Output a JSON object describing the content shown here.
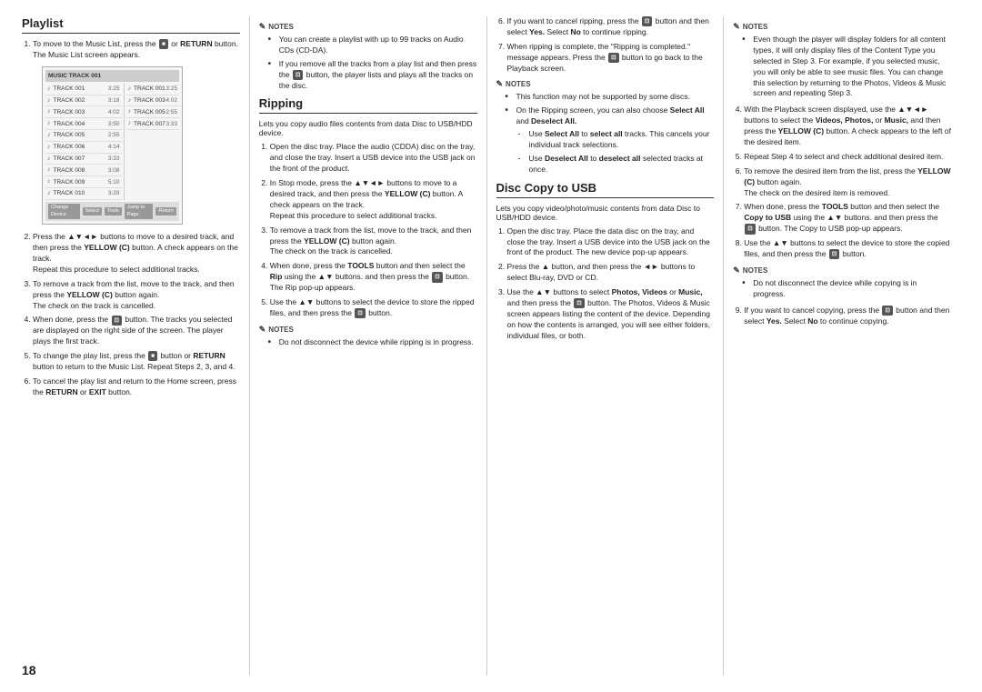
{
  "page": {
    "number": "18",
    "cols": {
      "col1": {
        "heading": "Playlist",
        "items": [
          {
            "num": "1",
            "text": "To move to the Music List, press the",
            "btn": "■",
            "text2": "or",
            "bold2": "RETURN",
            "text3": "button.",
            "sub": "The Music List screen appears."
          },
          {
            "num": "2",
            "text": "Press the ▲▼◄► buttons to move to a desired track, and then press the",
            "bold": "YELLOW (C)",
            "text2": "button. A check appears on the track.",
            "sub": "Repeat this procedure to select additional tracks."
          },
          {
            "num": "3",
            "text": "To remove a track from the list, move to the track, and then press the",
            "bold": "YELLOW (C)",
            "text2": "button again.",
            "sub": "The check on the track is cancelled."
          },
          {
            "num": "4",
            "text": "When done, press the",
            "btn": "■",
            "text2": "button. The tracks you selected are displayed on the right side of the screen. The player plays the first track."
          },
          {
            "num": "5",
            "text": "To change the play list, press the",
            "btn2": "■",
            "text2": "button or",
            "bold2": "RETURN",
            "text3": "button to return to the Music List. Repeat Steps 2, 3, and 4."
          },
          {
            "num": "6",
            "text": "To cancel the play list and return to the Home screen, press the",
            "bold": "RETURN",
            "text2": "or",
            "bold2": "EXIT",
            "text3": "button."
          }
        ],
        "musiclist": {
          "header": "MUSIC TRACK 001",
          "tracks": [
            {
              "name": "TRACK 001",
              "time": "3:25"
            },
            {
              "name": "TRACK 002",
              "time": "3:18"
            },
            {
              "name": "TRACK 003",
              "time": "4:02"
            },
            {
              "name": "TRACK 004",
              "time": "3:50"
            },
            {
              "name": "TRACK 005",
              "time": "2:55"
            },
            {
              "name": "TRACK 006",
              "time": "4:14"
            },
            {
              "name": "TRACK 007",
              "time": "3:33"
            },
            {
              "name": "TRACK 008",
              "time": "3:08"
            },
            {
              "name": "TRACK 009",
              "time": "5:10"
            },
            {
              "name": "TRACK 010",
              "time": "3:29"
            }
          ],
          "rightTracks": [
            {
              "name": "TRACK 001",
              "time": "3:25"
            },
            {
              "name": "TRACK 003",
              "time": "4:02"
            },
            {
              "name": "TRACK 005",
              "time": "2:55"
            },
            {
              "name": "TRACK 007",
              "time": "3:33"
            }
          ],
          "toolbar": [
            "Change Device",
            "Select",
            "Tools",
            "Jump to Page",
            "Return"
          ]
        }
      },
      "col2": {
        "heading": "Ripping",
        "notes1": {
          "label": "NOTES",
          "items": [
            "You can create a playlist with up to 99 tracks on Audio CDs (CD-DA).",
            "If you remove all the tracks from a play list and then press the button, the player lists and plays all the tracks on the disc."
          ]
        },
        "intro": "Lets you copy audio files contents from data Disc to USB/HDD device.",
        "items": [
          {
            "num": "1",
            "text": "Open the disc tray. Place the audio (CDDA) disc on the tray, and close the tray. Insert a USB device into the USB jack on the front of the product."
          },
          {
            "num": "2",
            "text": "In Stop mode, press the ▲▼◄► buttons to move to a desired track, and then press the",
            "bold": "YELLOW (C)",
            "text2": "button. A check appears on the track.",
            "sub": "Repeat this procedure to select additional tracks."
          },
          {
            "num": "3",
            "text": "To remove a track from the list, move to the track, and then press the",
            "bold": "YELLOW (C)",
            "text2": "button again.",
            "sub": "The check on the track is cancelled."
          },
          {
            "num": "4",
            "text": "When done, press the",
            "bold": "TOOLS",
            "text2": "button and then select the",
            "bold2": "Rip",
            "text3": "using the ▲▼ buttons. and then press the",
            "btn": "⊡",
            "text4": "button. The Rip pop-up appears."
          },
          {
            "num": "5",
            "text": "Use the ▲▼ buttons to select the device to store the ripped files, and then press the",
            "btn": "⊡",
            "text2": "button."
          }
        ],
        "notes2": {
          "label": "NOTES",
          "items": [
            "Do not disconnect the device while ripping is in progress."
          ]
        }
      },
      "col3": {
        "notes1": {
          "label": "NOTES",
          "items": [
            "This function may not be supported by some discs.",
            "On the Ripping screen, you can also choose Select All and Deselect All."
          ],
          "subitems": [
            {
              "bold": "Select All",
              "text": "to select all tracks.",
              "sub": "This cancels your individual track selections."
            },
            {
              "bold": "Deselect All",
              "text": "to deselect all selected tracks at once."
            }
          ]
        },
        "heading2": "Disc Copy to USB",
        "intro": "Lets you copy video/photo/music contents from data Disc to USB/HDD device.",
        "items": [
          {
            "num": "1",
            "text": "Open the disc tray. Place the data disc on the tray, and close the tray. Insert a USB device into the USB jack on the front of the product. The new device pop-up appears."
          },
          {
            "num": "2",
            "text": "Press the ▲ button, and then press the ◄► buttons to select Blu-ray, DVD or CD."
          },
          {
            "num": "3",
            "text": "Use the ▲▼ buttons to select",
            "bold": "Photos, Videos",
            "text2": "or",
            "bold2": "Music,",
            "text3": "and then press the",
            "btn": "⊡",
            "text4": "button. The Photos, Videos & Music screen appears listing the content of the device. Depending on how the contents is arranged, you will see either folders, individual files, or both."
          }
        ]
      },
      "col4": {
        "items6_cont": [
          {
            "num": "6",
            "text": "If you want to cancel ripping, press the",
            "btn": "⊡",
            "text2": "button and then select",
            "bold": "Yes.",
            "text3": "Select",
            "bold2": "No",
            "text4": "to continue ripping."
          },
          {
            "num": "7",
            "text": "When ripping is complete, the \"Ripping is completed.\" message appears. Press the",
            "btn": "⊡",
            "text2": "button to go back to the Playback screen."
          }
        ],
        "notes1": {
          "label": "NOTES",
          "items": [
            "This function may not be supported by some discs.",
            "On the Ripping screen, you can also choose Select All and Deselect All."
          ]
        },
        "items_cont": [
          {
            "num": "4",
            "text": "With the Playback screen displayed, use the ▲▼◄► buttons to select the",
            "bold": "Videos, Photos,",
            "text2": "or",
            "bold2": "Music,",
            "text3": "and then press the",
            "bold3": "YELLOW (C)",
            "text4": "button. A check appears to the left of the desired item."
          },
          {
            "num": "5",
            "text": "Repeat Step 4 to select and check additional desired item."
          },
          {
            "num": "6",
            "text": "To remove the desired item from the list, press the",
            "bold": "YELLOW (C)",
            "text2": "button again.",
            "sub": "The check on the desired item is removed."
          },
          {
            "num": "7",
            "text": "When done, press the",
            "bold": "TOOLS",
            "text2": "button and then select the",
            "bold2": "Copy to USB",
            "text3": "using the ▲▼ buttons. and then press the",
            "btn": "⊡",
            "text4": "button. The Copy to USB pop-up appears."
          },
          {
            "num": "8",
            "text": "Use the ▲▼ buttons to select the device to store the copied files, and then press the",
            "btn": "⊡",
            "text2": "button."
          }
        ],
        "notes2": {
          "label": "NOTES",
          "items": [
            "Do not disconnect the device while copying is in progress."
          ]
        },
        "items_end": [
          {
            "num": "9",
            "text": "If you want to cancel copying, press the",
            "btn": "⊡",
            "text2": "button and then select",
            "bold": "Yes.",
            "text3": "Select",
            "bold2": "No",
            "text4": "to continue copying."
          }
        ],
        "notes3": {
          "label": "NOTES",
          "items": [
            "Even though the player will display folders for all content types, it will only display files of the Content Type you selected in Step 3. For example, if you selected music, you will only be able to see music files. You can change this selection by returning to the Photos, Videos & Music screen and repeating Step 3."
          ]
        }
      }
    }
  }
}
